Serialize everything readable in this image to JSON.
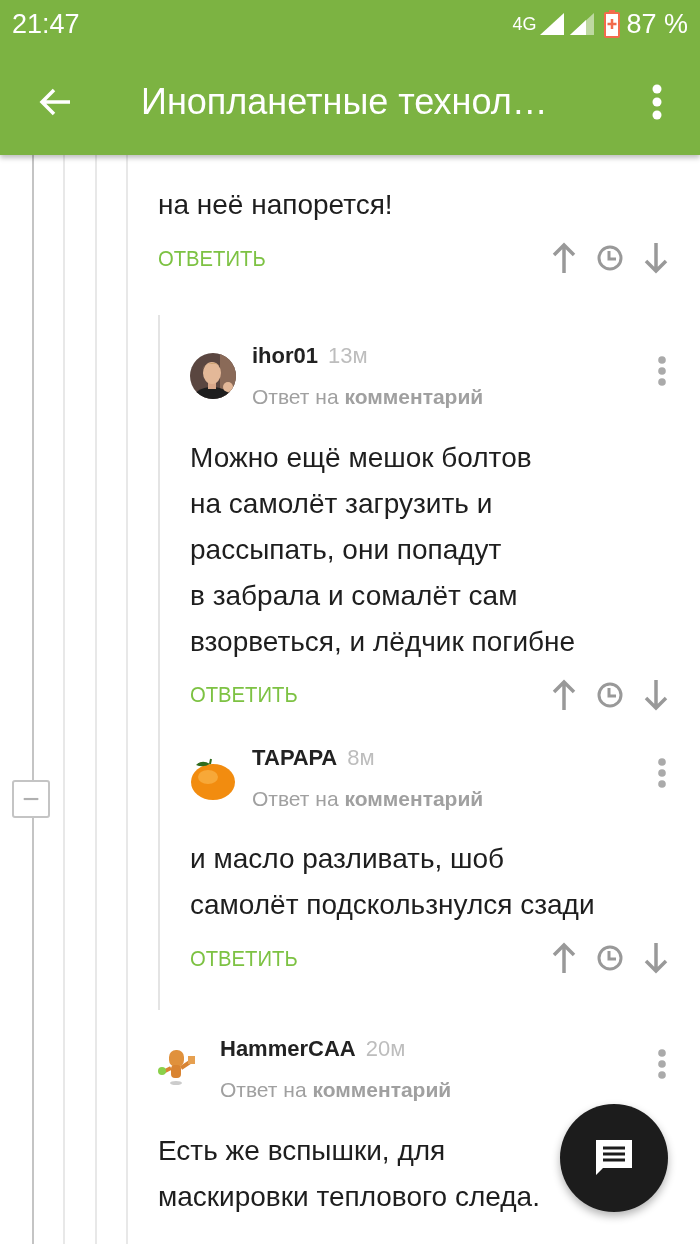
{
  "status_bar": {
    "time": "21:47",
    "network": "4G",
    "battery": "87 %"
  },
  "toolbar": {
    "title": "Инопланетные технол…"
  },
  "thread": {
    "collapse": "−"
  },
  "comments": [
    {
      "text": "на неё напорется!",
      "reply": "ОТВЕТИТЬ",
      "children": [
        {
          "author": "ihor01",
          "time": "13м",
          "reply_to": "Ответ на **комментарий**",
          "text": "Можно ещё мешок болтов\nна самолёт загрузить и\nрассыпать, они попадут\nв забрала и сомалёт сам\nвзорветься, и лёдчик погибне",
          "reply": "ОТВЕТИТЬ"
        },
        {
          "author": "ТАРАРА",
          "time": "8м",
          "reply_to": "Ответ на **комментарий**",
          "text": "и масло разливать, шоб\nсамолёт подскользнулся сзади",
          "reply": "ОТВЕТИТЬ"
        }
      ]
    },
    {
      "author": "HammerCAA",
      "time": "20м",
      "reply_to": "Ответ на **комментарий**",
      "text": "Есть же вспышки, для\nмаскировки теплового следа."
    }
  ]
}
